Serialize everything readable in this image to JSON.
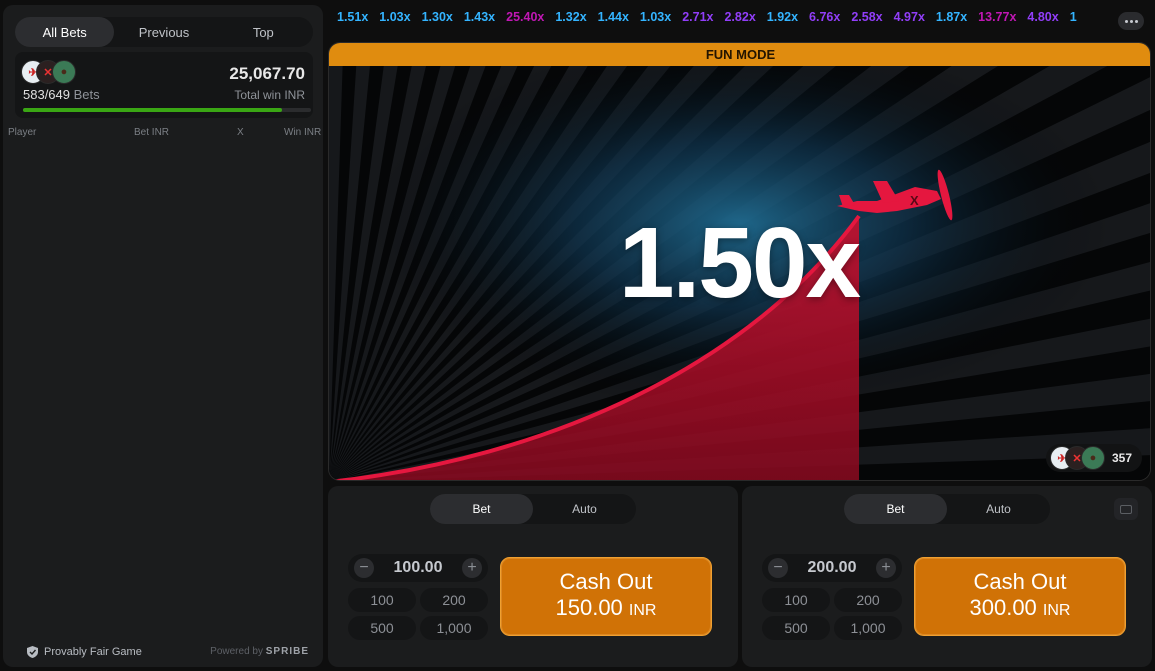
{
  "left_panel": {
    "tabs": [
      "All Bets",
      "Previous",
      "Top"
    ],
    "active_tab": "All Bets",
    "bets_placed": "583/649",
    "bets_label": "Bets",
    "bets_progress": 0.898,
    "total_win": "25,067.70",
    "total_win_label": "Total win INR",
    "columns": [
      "Player",
      "Bet INR",
      "X",
      "Win INR"
    ],
    "footer_fair": "Provably Fair Game",
    "footer_powered": "Powered by",
    "footer_brand": "SPRIBE"
  },
  "history": [
    {
      "value": "1.51x",
      "color": "#34b4ff"
    },
    {
      "value": "1.03x",
      "color": "#34b4ff"
    },
    {
      "value": "1.30x",
      "color": "#34b4ff"
    },
    {
      "value": "1.43x",
      "color": "#34b4ff"
    },
    {
      "value": "25.40x",
      "color": "#c017b4"
    },
    {
      "value": "1.32x",
      "color": "#34b4ff"
    },
    {
      "value": "1.44x",
      "color": "#34b4ff"
    },
    {
      "value": "1.03x",
      "color": "#34b4ff"
    },
    {
      "value": "2.71x",
      "color": "#913ef8"
    },
    {
      "value": "2.82x",
      "color": "#913ef8"
    },
    {
      "value": "1.92x",
      "color": "#34b4ff"
    },
    {
      "value": "6.76x",
      "color": "#913ef8"
    },
    {
      "value": "2.58x",
      "color": "#913ef8"
    },
    {
      "value": "4.97x",
      "color": "#913ef8"
    },
    {
      "value": "1.87x",
      "color": "#34b4ff"
    },
    {
      "value": "13.77x",
      "color": "#c017b4"
    },
    {
      "value": "4.80x",
      "color": "#913ef8"
    },
    {
      "value": "1",
      "color": "#34b4ff"
    }
  ],
  "game": {
    "mode_label": "FUN MODE",
    "multiplier": "1.50x",
    "online_count": "357",
    "plane_icon": "airplane-icon"
  },
  "bet_panels": [
    {
      "tabs": [
        "Bet",
        "Auto"
      ],
      "active_tab": "Bet",
      "amount": "100.00",
      "quick_amounts": [
        "100",
        "200",
        "500",
        "1,000"
      ],
      "cashout_label": "Cash Out",
      "cashout_amount": "150.00",
      "currency": "INR"
    },
    {
      "tabs": [
        "Bet",
        "Auto"
      ],
      "active_tab": "Bet",
      "amount": "200.00",
      "quick_amounts": [
        "100",
        "200",
        "500",
        "1,000"
      ],
      "cashout_label": "Cash Out",
      "cashout_amount": "300.00",
      "currency": "INR"
    }
  ],
  "colors": {
    "accent_orange": "#d07206",
    "fun_mode_bar": "#e08c0f",
    "curve_red": "#e5173f",
    "progress_green": "#3aa614"
  }
}
